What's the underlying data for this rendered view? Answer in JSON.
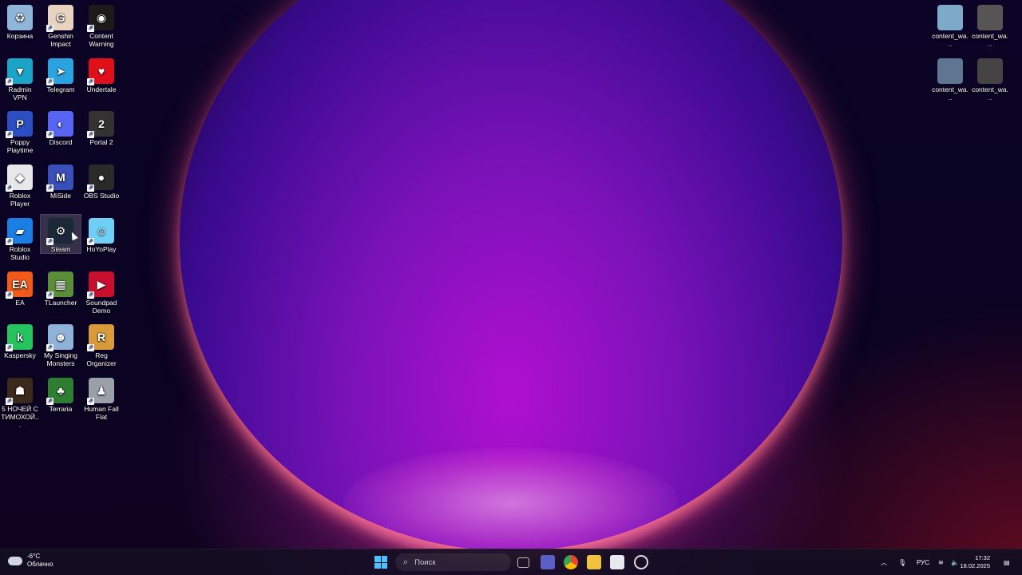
{
  "desktop": {
    "icons_left": [
      {
        "label": "Корзина",
        "color": "#8fb6d8",
        "glyph": "♻"
      },
      {
        "label": "Genshin Impact",
        "color": "#e8d3c0",
        "glyph": "G"
      },
      {
        "label": "Content Warning",
        "color": "#1b1b1b",
        "glyph": "◉"
      },
      {
        "label": "Radmin VPN",
        "color": "#1aa4c8",
        "glyph": "▼"
      },
      {
        "label": "Telegram",
        "color": "#2aa3e0",
        "glyph": "➤"
      },
      {
        "label": "Undertale",
        "color": "#e0101b",
        "glyph": "♥"
      },
      {
        "label": "Poppy Playtime",
        "color": "#2b4fc2",
        "glyph": "P"
      },
      {
        "label": "Discord",
        "color": "#5865f2",
        "glyph": "◐"
      },
      {
        "label": "Portal 2",
        "color": "#333",
        "glyph": "2"
      },
      {
        "label": "Roblox Player",
        "color": "#e8e8e8",
        "glyph": "◆"
      },
      {
        "label": "MiSide",
        "color": "#3a4fb8",
        "glyph": "M"
      },
      {
        "label": "OBS Studio",
        "color": "#2a2a2a",
        "glyph": "●"
      },
      {
        "label": "Roblox Studio",
        "color": "#1b7ee5",
        "glyph": "▰"
      },
      {
        "label": "Steam",
        "color": "#1b2838",
        "glyph": "⚙"
      },
      {
        "label": "HoYoPlay",
        "color": "#6fcff5",
        "glyph": "☺"
      },
      {
        "label": "EA",
        "color": "#f25a1a",
        "glyph": "EA"
      },
      {
        "label": "TLauncher",
        "color": "#5a8c3a",
        "glyph": "▦"
      },
      {
        "label": "Soundpad Demo",
        "color": "#c8102e",
        "glyph": "▶"
      },
      {
        "label": "Kaspersky",
        "color": "#25c45e",
        "glyph": "k"
      },
      {
        "label": "My Singing Monsters",
        "color": "#8fb2d8",
        "glyph": "☻"
      },
      {
        "label": "Reg Organizer",
        "color": "#d89a3a",
        "glyph": "R"
      },
      {
        "label": "5 НОЧЕЙ С ТИМОХОЙ...",
        "color": "#3a2a1a",
        "glyph": "☗"
      },
      {
        "label": "Terraria",
        "color": "#2e7d32",
        "glyph": "♣"
      },
      {
        "label": "Human Fall Flat",
        "color": "#9aa0a8",
        "glyph": "♟"
      }
    ],
    "icons_right": [
      {
        "label": "content_wa...",
        "color": "#7fa9c9"
      },
      {
        "label": "content_wa...",
        "color": "#555"
      },
      {
        "label": "content_wa...",
        "color": "#5f7591"
      },
      {
        "label": "content_wa...",
        "color": "#444"
      }
    ]
  },
  "taskbar": {
    "weather_temp": "-6°C",
    "weather_text": "Облачно",
    "search_placeholder": "Поиск",
    "language": "РУС",
    "time": "17:32",
    "date": "18.02.2025"
  }
}
